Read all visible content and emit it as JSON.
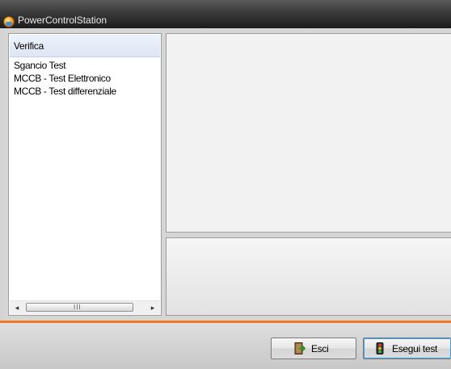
{
  "window": {
    "title": "PowerControlStation"
  },
  "list": {
    "header": "Verifica",
    "items": [
      "Sgancio Test",
      "MCCB - Test Elettronico",
      "MCCB - Test differenziale"
    ],
    "scroll_left": "◂",
    "scroll_right": "▸",
    "scroll_grip": "III"
  },
  "buttons": {
    "exit_label": "Esci",
    "run_label": "Esegui test"
  },
  "colors": {
    "accent_line": "#f07a24",
    "title_bar": "#1c1c1c",
    "list_header": "#dde6f4"
  },
  "icons": {
    "app": "app-logo-icon",
    "exit": "exit-door-icon",
    "run": "traffic-light-icon"
  }
}
